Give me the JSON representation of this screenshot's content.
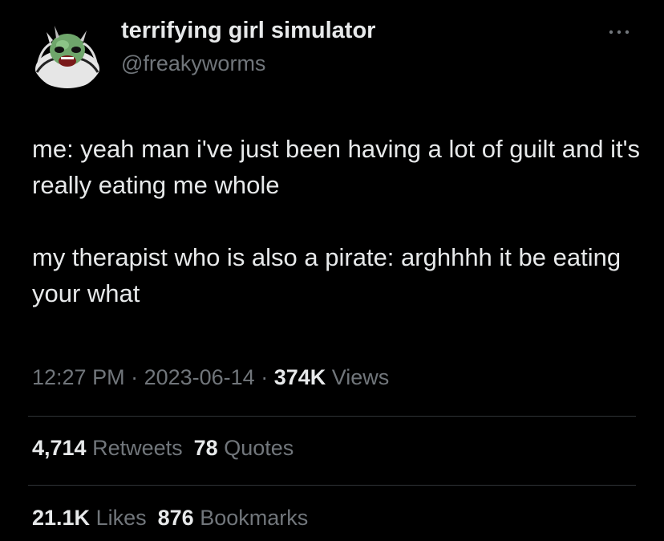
{
  "author": {
    "display_name": "terrifying girl simulator",
    "handle": "@freakyworms",
    "avatar_icon": "cartoon-character-avatar"
  },
  "more_icon": "more-horizontal-icon",
  "tweet": {
    "paragraphs": [
      "me: yeah man i've just been having a lot of guilt and it's really eating me whole",
      "my therapist who is also a pirate: arghhhh it be eating your what"
    ]
  },
  "meta": {
    "time": "12:27 PM",
    "separator": " · ",
    "date": "2023-06-14",
    "views_count": "374K",
    "views_label": "Views"
  },
  "stats": {
    "retweets_count": "4,714",
    "retweets_label": "Retweets",
    "quotes_count": "78",
    "quotes_label": "Quotes",
    "likes_count": "21.1K",
    "likes_label": "Likes",
    "bookmarks_count": "876",
    "bookmarks_label": "Bookmarks"
  },
  "colors": {
    "background": "#000000",
    "primary_text": "#e7e9ea",
    "secondary_text": "#71767b",
    "divider": "#2f3336"
  }
}
